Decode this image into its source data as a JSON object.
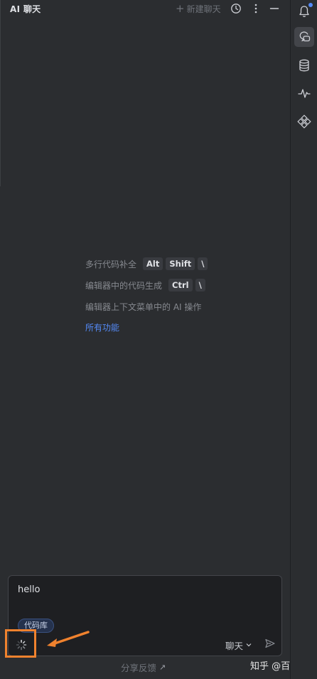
{
  "header": {
    "title": "AI 聊天",
    "new_chat_label": "新建聊天",
    "icons": [
      "plus-icon",
      "history-icon",
      "more-icon",
      "minimize-icon"
    ]
  },
  "empty_state": {
    "hints": [
      {
        "label": "多行代码补全",
        "keys": [
          "Alt",
          "Shift",
          "\\"
        ]
      },
      {
        "label": "编辑器中的代码生成",
        "keys": [
          "Ctrl",
          "\\"
        ]
      },
      {
        "label": "编辑器上下文菜单中的 AI 操作",
        "keys": []
      }
    ],
    "all_features_link": "所有功能"
  },
  "input": {
    "value": "hello",
    "context_chip": "代码库",
    "mode_value": "聊天",
    "send_icon": "send-icon",
    "loading_icon": "spinner-icon"
  },
  "footer": {
    "feedback_label": "分享反馈",
    "feedback_icon": "external-link-icon"
  },
  "watermark": "知乎 @百里奚",
  "sidebar": {
    "icons": [
      "bell-icon",
      "ai-chat-icon",
      "database-icon",
      "pulse-icon",
      "plugins-icon"
    ]
  },
  "colors": {
    "background": "#2b2d30",
    "input_background": "#1e1f22",
    "link": "#548af7",
    "annotation": "#f0822e",
    "notification_dot": "#548af7"
  }
}
